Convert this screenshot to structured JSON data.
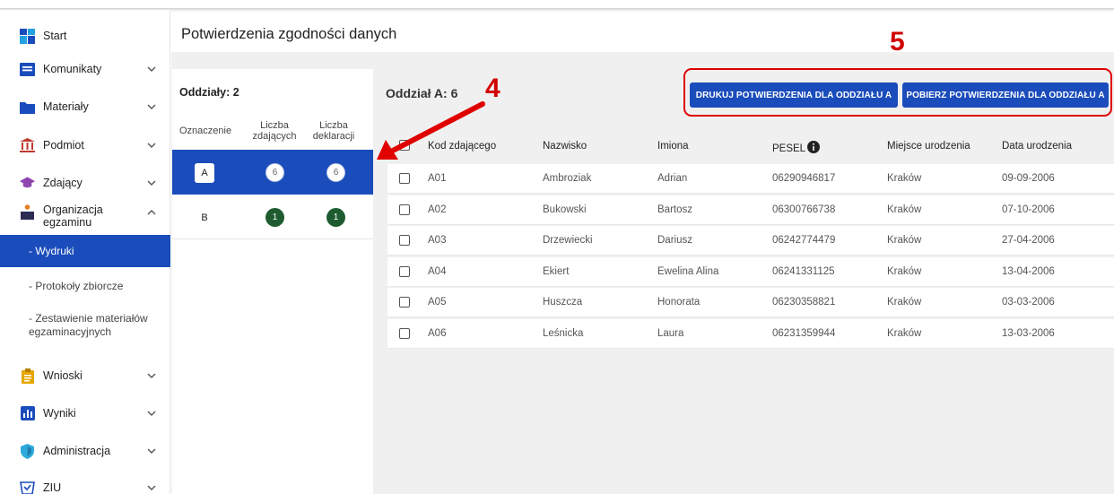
{
  "page_title": "Potwierdzenia zgodności danych",
  "sidebar": {
    "items": [
      {
        "label": "Start",
        "icon": "dashboard-icon",
        "chevron": false
      },
      {
        "label": "Komunikaty",
        "icon": "message-icon",
        "chevron": true
      },
      {
        "label": "Materiały",
        "icon": "folder-icon",
        "chevron": true
      },
      {
        "label": "Podmiot",
        "icon": "institution-icon",
        "chevron": true
      },
      {
        "label": "Zdający",
        "icon": "graduation-cap-icon",
        "chevron": true
      },
      {
        "label": "Organizacja egzaminu",
        "icon": "podium-icon",
        "chevron": "up"
      },
      {
        "label": "Wnioski",
        "icon": "clipboard-icon",
        "chevron": true
      },
      {
        "label": "Wyniki",
        "icon": "bar-chart-icon",
        "chevron": true
      },
      {
        "label": "Administracja",
        "icon": "shield-icon",
        "chevron": true
      },
      {
        "label": "ZIU",
        "icon": "ziu-icon",
        "chevron": true
      }
    ],
    "sub_items": [
      {
        "label": "- Wydruki",
        "active": true
      },
      {
        "label": "- Protokoły zbiorcze",
        "active": false
      },
      {
        "label": "- Zestawienie materiałów egzaminacyjnych",
        "active": false
      }
    ]
  },
  "branches": {
    "count_label": "Oddziały: 2",
    "headers": {
      "designation": "Oznaczenie",
      "examinees": "Liczba zdających",
      "declarations": "Liczba deklaracji"
    },
    "rows": [
      {
        "tag": "A",
        "examinees": "6",
        "declarations": "6",
        "active": true
      },
      {
        "tag": "B",
        "examinees": "1",
        "declarations": "1",
        "active": false
      }
    ]
  },
  "department": {
    "title": "Oddział A: 6",
    "print_button": "DRUKUJ POTWIERDZENIA DLA ODDZIAŁU A",
    "download_button": "POBIERZ POTWIERDZENIA DLA ODDZIAŁU A"
  },
  "table": {
    "headers": [
      "Kod zdającego",
      "Nazwisko",
      "Imiona",
      "PESEL",
      "Miejsce urodzenia",
      "Data urodzenia"
    ],
    "rows": [
      [
        "A01",
        "Ambroziak",
        "Adrian",
        "06290946817",
        "Kraków",
        "09-09-2006"
      ],
      [
        "A02",
        "Bukowski",
        "Bartosz",
        "06300766738",
        "Kraków",
        "07-10-2006"
      ],
      [
        "A03",
        "Drzewiecki",
        "Dariusz",
        "06242774479",
        "Kraków",
        "27-04-2006"
      ],
      [
        "A04",
        "Ekiert",
        "Ewelina Alina",
        "06241331125",
        "Kraków",
        "13-04-2006"
      ],
      [
        "A05",
        "Huszcza",
        "Honorata",
        "06230358821",
        "Kraków",
        "03-03-2006"
      ],
      [
        "A06",
        "Leśnicka",
        "Laura",
        "06231359944",
        "Kraków",
        "13-03-2006"
      ]
    ]
  },
  "annotations": {
    "n4": "4",
    "n5": "5"
  },
  "colors": {
    "primary": "#1a4cbb",
    "dark_green": "#1e5c30",
    "annotation_red": "#e00000"
  }
}
